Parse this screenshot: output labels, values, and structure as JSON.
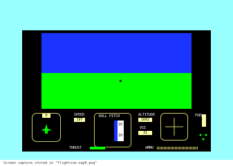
{
  "cockpit": {
    "speed_label": "SPEED",
    "speed_value": "197",
    "roll_pitch_label": "ROLL PITCH",
    "altitude_label": "ALTITUDE",
    "altitude_value": "1602",
    "vsi_label": "VSI",
    "vsi_value": "31",
    "fuel_label": "FUEL",
    "thrust_label": "THRUST",
    "ammo_label": "AMMO",
    "attitude_value": "0",
    "roll_marks": [
      "10",
      "10"
    ]
  },
  "status": {
    "message": "Screen capture stored in \"flightsim-cap0.png\""
  }
}
